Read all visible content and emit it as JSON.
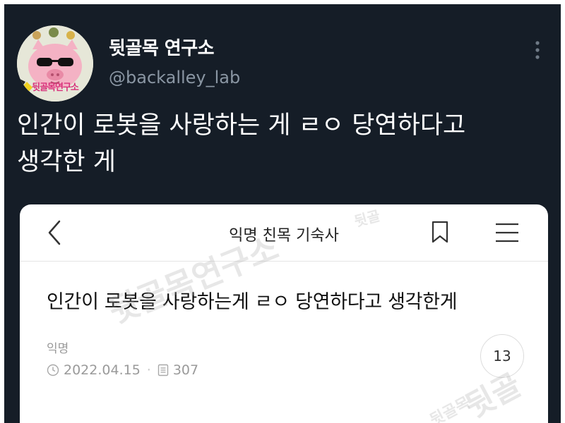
{
  "tweet": {
    "display_name": "뒷골목 연구소",
    "handle": "@backalley_lab",
    "text": "인간이 로봇을 사랑하는 게 ㄹㅇ 당연하다고\n생각한 게",
    "avatar_label": "뒷골목연구소"
  },
  "card": {
    "board_title": "익명 친목 기숙사",
    "post_title": "인간이 로봇을 사랑하는게 ㄹㅇ 당연하다고 생각한게",
    "author": "익명",
    "date": "2022.04.15",
    "views": "307",
    "comment_count": "13"
  },
  "icons": [
    "more-vertical-icon",
    "back-arrow-icon",
    "bookmark-icon",
    "menu-icon",
    "clock-icon",
    "document-icon"
  ],
  "watermarks": [
    "뒷골목연구소",
    "뒷골",
    "뒷골목",
    "뒷골"
  ],
  "colors": {
    "tweet_bg": "#151d27",
    "handle": "#8a96a3",
    "card_bg": "#ffffff",
    "meta": "#9a9a9a"
  }
}
